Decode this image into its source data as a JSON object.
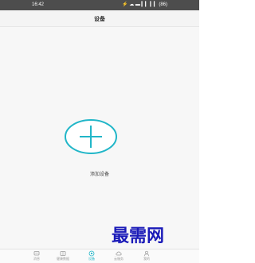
{
  "status_bar": {
    "time": "16:42",
    "icons_text": "⚡ ☁ ▬ ▎▎ ▎▎ (86)"
  },
  "header": {
    "title": "设备"
  },
  "main": {
    "add_device_label": "添加设备",
    "add_icon": "plus-circle-icon"
  },
  "tabs": [
    {
      "label": "消息",
      "icon": "message-icon"
    },
    {
      "label": "健康数据",
      "icon": "health-data-icon"
    },
    {
      "label": "设备",
      "icon": "device-icon"
    },
    {
      "label": "云服务",
      "icon": "cloud-icon"
    },
    {
      "label": "我的",
      "icon": "profile-icon"
    }
  ],
  "watermark": {
    "text": "最需网"
  },
  "colors": {
    "accent": "#21b6c8",
    "status_bar": "#4d4d4d",
    "watermark": "#1a1ab8"
  }
}
